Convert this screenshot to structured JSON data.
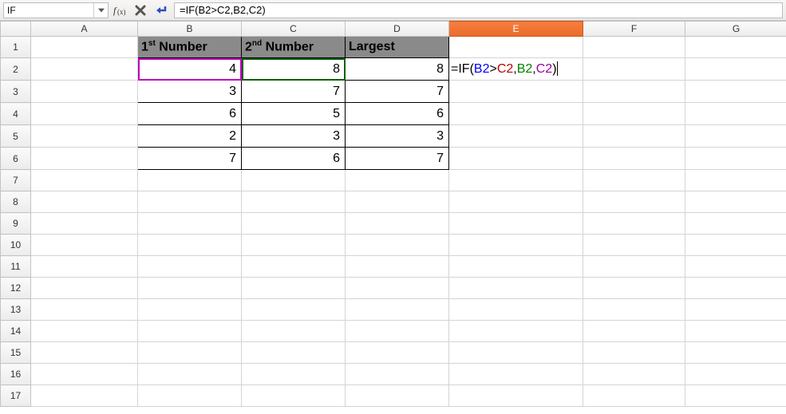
{
  "formula_bar": {
    "name_box_value": "IF",
    "formula_input_value": "=IF(B2>C2,B2,C2)"
  },
  "columns": [
    "A",
    "B",
    "C",
    "D",
    "E",
    "F",
    "G"
  ],
  "row_count": 17,
  "active_row": 2,
  "active_col": "E",
  "headers": {
    "b1_pre": "1",
    "b1_sup": "st",
    "b1_post": " Number",
    "c1_pre": "2",
    "c1_sup": "nd",
    "c1_post": " Number",
    "d1": "Largest"
  },
  "data": {
    "B": [
      4,
      3,
      6,
      2,
      7
    ],
    "C": [
      8,
      7,
      5,
      3,
      6
    ],
    "D": [
      8,
      7,
      6,
      3,
      7
    ]
  },
  "edit_cell_tokens": {
    "t0": "=IF(",
    "b2": "B2",
    "t1": ">",
    "c2a": "C2",
    "t2": ",",
    "b2b": "B2",
    "t3": ",",
    "c2b": "C2",
    "t4": ")"
  },
  "chart_data": {
    "type": "table",
    "title": "",
    "columns": [
      "1st Number",
      "2nd Number",
      "Largest"
    ],
    "rows": [
      [
        4,
        8,
        8
      ],
      [
        3,
        7,
        7
      ],
      [
        6,
        5,
        6
      ],
      [
        2,
        3,
        3
      ],
      [
        7,
        6,
        7
      ]
    ]
  }
}
